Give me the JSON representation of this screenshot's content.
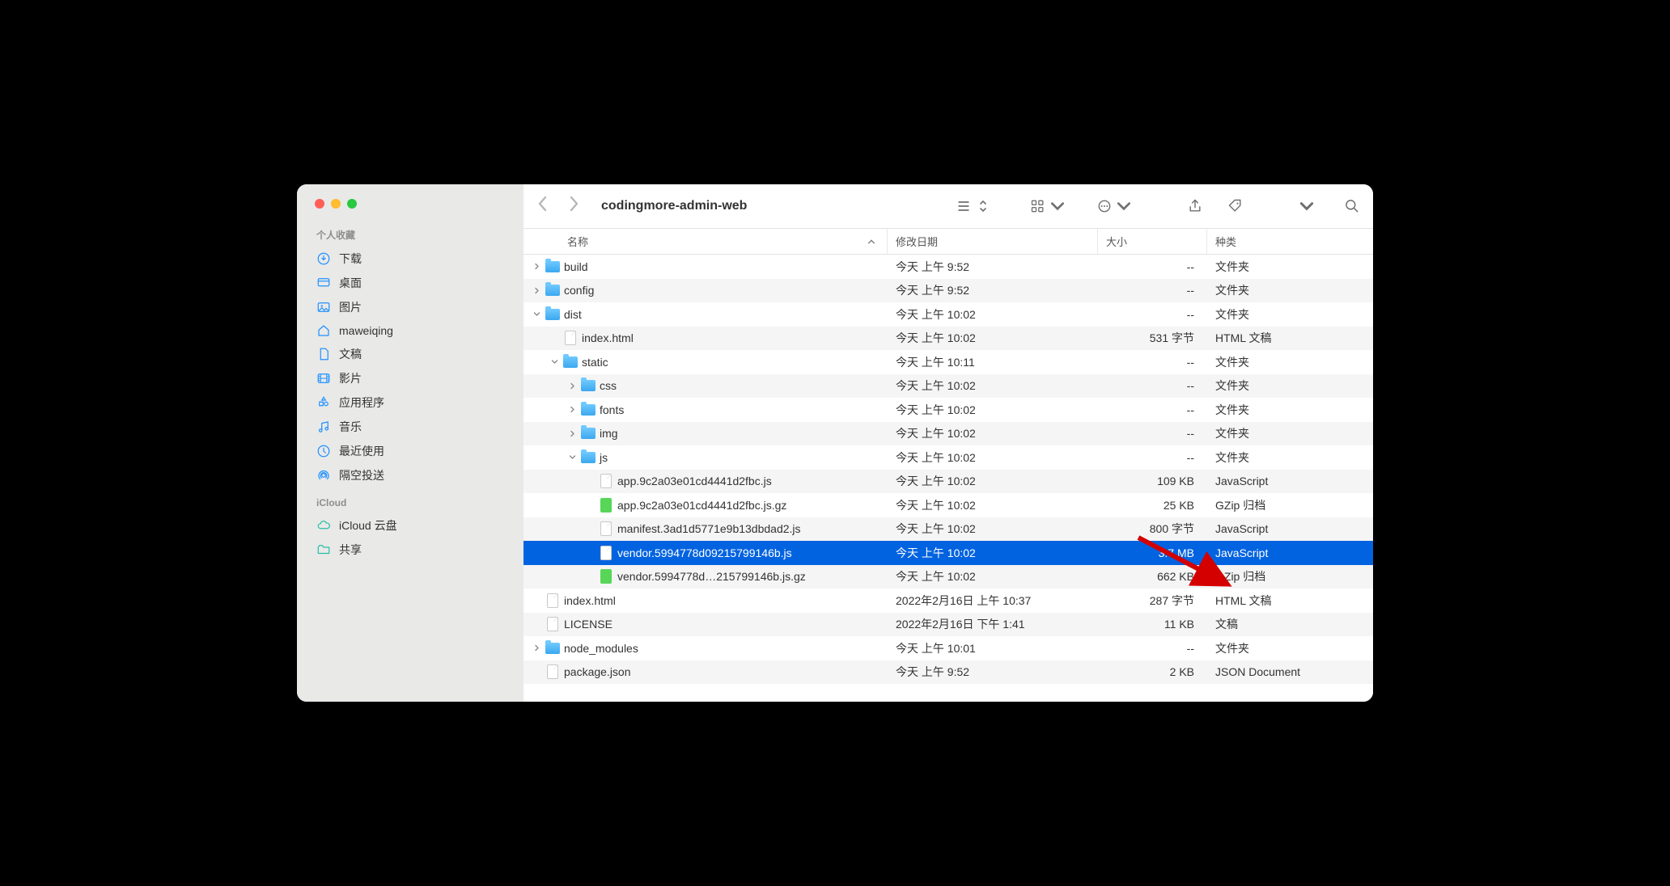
{
  "window_title": "codingmore-admin-web",
  "sidebar": {
    "favorites_label": "个人收藏",
    "items": [
      {
        "icon": "download",
        "label": "下载"
      },
      {
        "icon": "desktop",
        "label": "桌面"
      },
      {
        "icon": "pictures",
        "label": "图片"
      },
      {
        "icon": "home",
        "label": "maweiqing"
      },
      {
        "icon": "documents",
        "label": "文稿"
      },
      {
        "icon": "movies",
        "label": "影片"
      },
      {
        "icon": "apps",
        "label": "应用程序"
      },
      {
        "icon": "music",
        "label": "音乐"
      },
      {
        "icon": "recents",
        "label": "最近使用"
      },
      {
        "icon": "airdrop",
        "label": "隔空投送"
      }
    ],
    "icloud_label": "iCloud",
    "icloud_items": [
      {
        "icon": "icloud",
        "label": "iCloud 云盘"
      },
      {
        "icon": "shared",
        "label": "共享"
      }
    ]
  },
  "columns": {
    "name": "名称",
    "date": "修改日期",
    "size": "大小",
    "kind": "种类"
  },
  "files": [
    {
      "indent": 0,
      "chev": "right",
      "icon": "folder",
      "name": "build",
      "date": "今天 上午 9:52",
      "size": "--",
      "kind": "文件夹",
      "alt": false
    },
    {
      "indent": 0,
      "chev": "right",
      "icon": "folder",
      "name": "config",
      "date": "今天 上午 9:52",
      "size": "--",
      "kind": "文件夹",
      "alt": true
    },
    {
      "indent": 0,
      "chev": "down",
      "icon": "folder",
      "name": "dist",
      "date": "今天 上午 10:02",
      "size": "--",
      "kind": "文件夹",
      "alt": false
    },
    {
      "indent": 1,
      "chev": "",
      "icon": "file",
      "name": "index.html",
      "date": "今天 上午 10:02",
      "size": "531 字节",
      "kind": "HTML 文稿",
      "alt": true
    },
    {
      "indent": 1,
      "chev": "down",
      "icon": "folder",
      "name": "static",
      "date": "今天 上午 10:11",
      "size": "--",
      "kind": "文件夹",
      "alt": false
    },
    {
      "indent": 2,
      "chev": "right",
      "icon": "folder",
      "name": "css",
      "date": "今天 上午 10:02",
      "size": "--",
      "kind": "文件夹",
      "alt": true
    },
    {
      "indent": 2,
      "chev": "right",
      "icon": "folder",
      "name": "fonts",
      "date": "今天 上午 10:02",
      "size": "--",
      "kind": "文件夹",
      "alt": false
    },
    {
      "indent": 2,
      "chev": "right",
      "icon": "folder",
      "name": "img",
      "date": "今天 上午 10:02",
      "size": "--",
      "kind": "文件夹",
      "alt": true
    },
    {
      "indent": 2,
      "chev": "down",
      "icon": "folder",
      "name": "js",
      "date": "今天 上午 10:02",
      "size": "--",
      "kind": "文件夹",
      "alt": false
    },
    {
      "indent": 3,
      "chev": "",
      "icon": "file",
      "name": "app.9c2a03e01cd4441d2fbc.js",
      "date": "今天 上午 10:02",
      "size": "109 KB",
      "kind": "JavaScript",
      "alt": true
    },
    {
      "indent": 3,
      "chev": "",
      "icon": "gz",
      "name": "app.9c2a03e01cd4441d2fbc.js.gz",
      "date": "今天 上午 10:02",
      "size": "25 KB",
      "kind": "GZip 归档",
      "alt": false
    },
    {
      "indent": 3,
      "chev": "",
      "icon": "file",
      "name": "manifest.3ad1d5771e9b13dbdad2.js",
      "date": "今天 上午 10:02",
      "size": "800 字节",
      "kind": "JavaScript",
      "alt": true
    },
    {
      "indent": 3,
      "chev": "",
      "icon": "file",
      "name": "vendor.5994778d09215799146b.js",
      "date": "今天 上午 10:02",
      "size": "3.7 MB",
      "kind": "JavaScript",
      "sel": true
    },
    {
      "indent": 3,
      "chev": "",
      "icon": "gz",
      "name": "vendor.5994778d…215799146b.js.gz",
      "date": "今天 上午 10:02",
      "size": "662 KB",
      "kind": "GZip 归档",
      "alt": true
    },
    {
      "indent": 0,
      "chev": "",
      "icon": "file",
      "name": "index.html",
      "date": "2022年2月16日 上午 10:37",
      "size": "287 字节",
      "kind": "HTML 文稿",
      "alt": false
    },
    {
      "indent": 0,
      "chev": "",
      "icon": "file",
      "name": "LICENSE",
      "date": "2022年2月16日 下午 1:41",
      "size": "11 KB",
      "kind": "文稿",
      "alt": true
    },
    {
      "indent": 0,
      "chev": "right",
      "icon": "folder",
      "name": "node_modules",
      "date": "今天 上午 10:01",
      "size": "--",
      "kind": "文件夹",
      "alt": false
    },
    {
      "indent": 0,
      "chev": "",
      "icon": "file",
      "name": "package.json",
      "date": "今天 上午 9:52",
      "size": "2 KB",
      "kind": "JSON Document",
      "alt": true
    }
  ]
}
